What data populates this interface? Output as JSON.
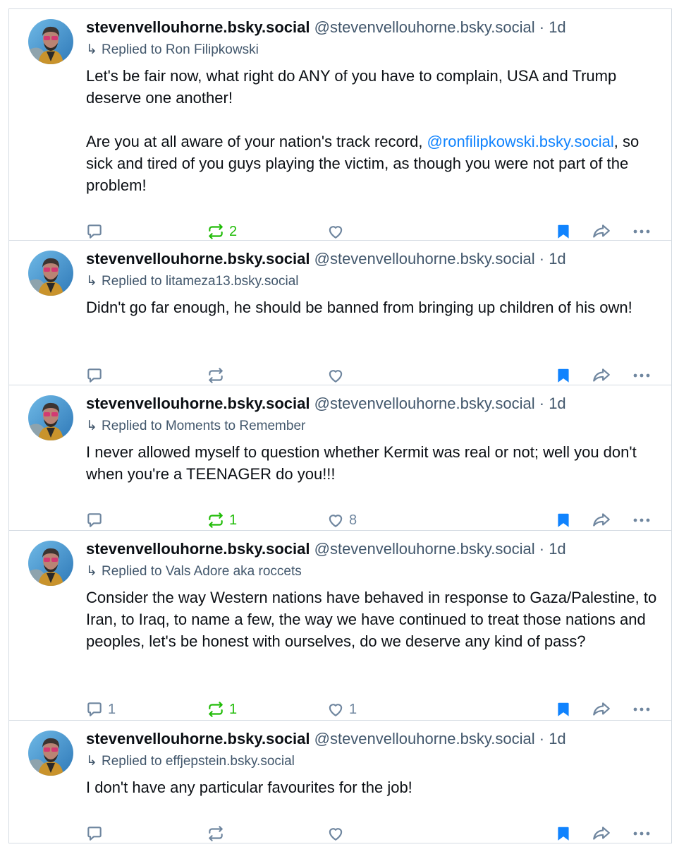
{
  "posts": [
    {
      "name": "stevenvellouhorne.bsky.social",
      "handle": "@stevenvellouhorne.bsky.social",
      "time": "1d",
      "reply_to": "Replied to Ron Filipkowski",
      "paragraphs": [
        [
          "Let's be fair now, what right do ANY of you have to complain, USA and Trump deserve one another!"
        ],
        [
          "Are you at all aware of your nation's track record, ",
          "@ronfilipkowski.bsky.social",
          ", so sick and tired of you guys playing the victim, as though you were not part of the problem!"
        ]
      ],
      "replies": "",
      "reposts": "2",
      "reposted": true,
      "likes": "",
      "bookmarked": true
    },
    {
      "name": "stevenvellouhorne.bsky.social",
      "handle": "@stevenvellouhorne.bsky.social",
      "time": "1d",
      "reply_to": "Replied to litameza13.bsky.social",
      "paragraphs": [
        [
          "Didn't go far enough, he should be banned from bringing up children of his own!"
        ]
      ],
      "replies": "",
      "reposts": "",
      "reposted": false,
      "likes": "",
      "bookmarked": true
    },
    {
      "name": "stevenvellouhorne.bsky.social",
      "handle": "@stevenvellouhorne.bsky.social",
      "time": "1d",
      "reply_to": "Replied to Moments to Remember",
      "paragraphs": [
        [
          "I never allowed myself to question whether Kermit was real or not; well you don't when you're a TEENAGER do you!!!"
        ]
      ],
      "replies": "",
      "reposts": "1",
      "reposted": true,
      "likes": "8",
      "bookmarked": true
    },
    {
      "name": "stevenvellouhorne.bsky.social",
      "handle": "@stevenvellouhorne.bsky.social",
      "time": "1d",
      "reply_to": "Replied to Vals Adore aka roccets",
      "paragraphs": [
        [
          "Consider the way Western nations have behaved in response to Gaza/Palestine, to Iran, to Iraq, to name a few, the way we have continued to treat those nations and peoples, let's be honest with ourselves, do we deserve any kind of pass?"
        ]
      ],
      "replies": "1",
      "reposts": "1",
      "reposted": true,
      "likes": "1",
      "bookmarked": true
    },
    {
      "name": "stevenvellouhorne.bsky.social",
      "handle": "@stevenvellouhorne.bsky.social",
      "time": "1d",
      "reply_to": "Replied to effjepstein.bsky.social",
      "paragraphs": [
        [
          "I don't have any particular favourites for the job!"
        ]
      ],
      "replies": "",
      "reposts": "",
      "reposted": false,
      "likes": "",
      "bookmarked": true
    }
  ],
  "colors": {
    "text": "#0b0f14",
    "muted": "#42576c",
    "icon": "#6f869f",
    "mention": "#1083fe",
    "bookmark": "#1083fe",
    "repost_active": "#20bc07",
    "border": "#d4dbe2"
  },
  "icons": {
    "reply": "comment-icon",
    "repost": "repost-icon",
    "like": "heart-icon",
    "bookmark": "bookmark-icon",
    "share": "share-icon",
    "more": "more-icon",
    "reply_indicator": "reply-arrow-icon"
  }
}
